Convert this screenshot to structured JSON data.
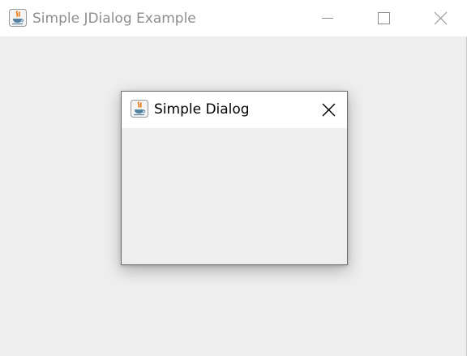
{
  "main_window": {
    "title": "Simple JDialog Example",
    "title_icon": "java-cup-icon",
    "buttons": {
      "minimize_icon": "minimize-icon",
      "maximize_icon": "maximize-icon",
      "close_icon": "close-icon"
    }
  },
  "dialog": {
    "title": "Simple Dialog",
    "title_icon": "java-cup-icon",
    "close_icon": "close-icon"
  },
  "colors": {
    "titlebar_bg": "#ffffff",
    "content_bg": "#eeeeee",
    "inactive_title_text": "#8e8e8e",
    "active_title_text": "#000000",
    "icon_orange": "#e76f00",
    "icon_blue": "#5382a1"
  }
}
